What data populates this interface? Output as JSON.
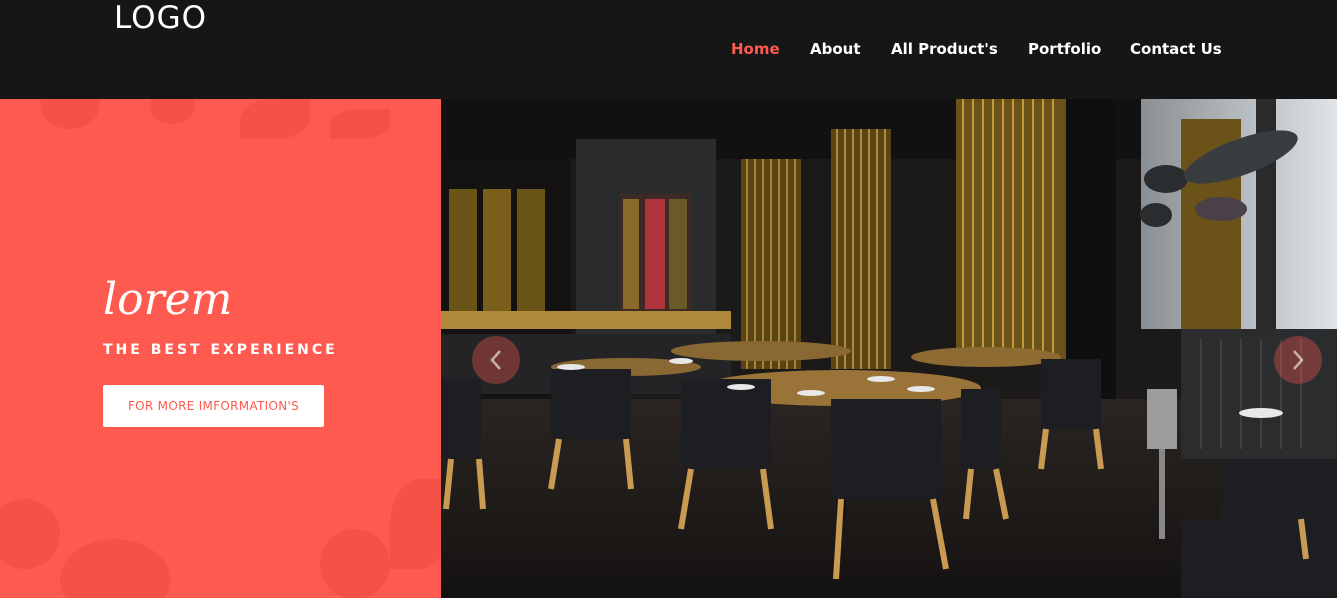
{
  "header": {
    "logo": "LOGO",
    "nav": [
      {
        "label": "Home",
        "active": true
      },
      {
        "label": "About",
        "active": false
      },
      {
        "label": "All Product's",
        "active": false
      },
      {
        "label": "Portfolio",
        "active": false
      },
      {
        "label": "Contact Us",
        "active": false
      }
    ]
  },
  "hero": {
    "script_title": "lorem",
    "tagline": "THE BEST EXPERIENCE",
    "cta_label": "FOR MORE IMFORMATION'S",
    "image_subject": "restaurant interior with round wooden tables and black chairs",
    "slider": {
      "prev_icon": "chevron-left-icon",
      "next_icon": "chevron-right-icon"
    }
  },
  "colors": {
    "accent": "#ff5a4f",
    "header_bg": "#161616",
    "text_light": "#ffffff"
  }
}
